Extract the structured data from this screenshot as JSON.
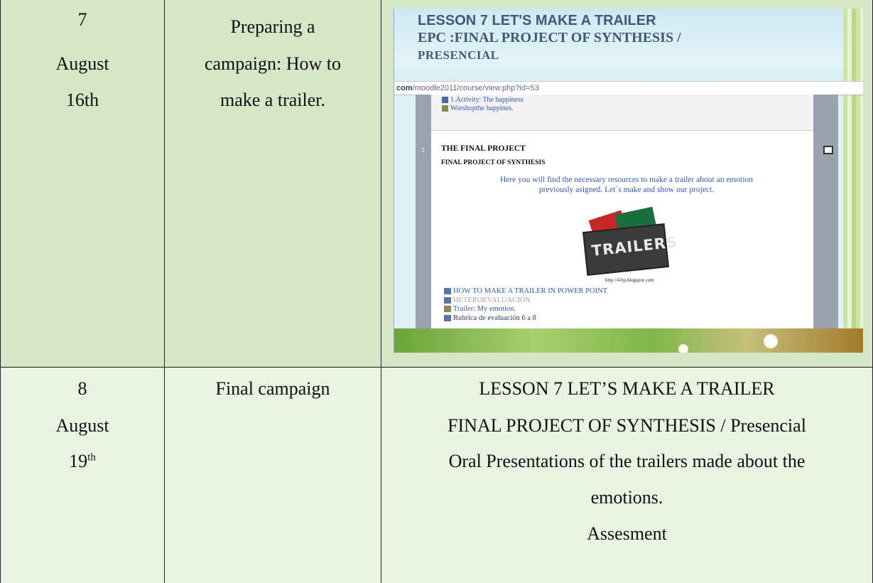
{
  "rows": [
    {
      "number": "7",
      "month": "August",
      "day": "16th",
      "activity_lines": [
        "Preparing a",
        "campaign: How to",
        "make a trailer."
      ],
      "screenshot": {
        "title_line1": "LESSON 7   LET'S MAKE A TRAILER",
        "title_line2": "EPC :FINAL PROJECT OF SYNTHESIS /",
        "title_line3": "PRESENCIAL",
        "url_host": "com",
        "url_path": "/moodle2011/course/view.php?id=53",
        "prev_items": [
          "1.Activity: The happiness",
          "Worshopthe happines."
        ],
        "section_number": "3",
        "section_title": "THE FINAL PROJECT",
        "section_subtitle": "FINAL PROJECT OF SYNTHESIS",
        "description_line1": "Here you will find the necessary resources to make a trailer about an  emotion",
        "description_line2": "previously asigned. Let´s make and show our project.",
        "image_text": "TRAILERS",
        "image_credit": "http://4.bp.blogspot.com",
        "links": [
          "HOW TO MAKE A TRAILER IN POWER POINT",
          "HETEROEVALUACIÓN",
          "Trailer: My emotion.",
          "Rubrica de evaluación 6 a 8"
        ]
      }
    },
    {
      "number": "8",
      "month": "August",
      "day": "19",
      "day_suffix": "th",
      "activity": "Final campaign",
      "content_lines": [
        "LESSON 7   LET’S MAKE A TRAILER",
        "FINAL PROJECT OF SYNTHESIS / Presencial",
        "Oral Presentations of the trailers made about the",
        "emotions.",
        "Assesment"
      ]
    }
  ],
  "colors": {
    "row1_bg": "#d7e6c6",
    "row2_bg": "#eaf2e2",
    "lesson_title": "#3e5b73",
    "link_blue": "#3357b8"
  }
}
